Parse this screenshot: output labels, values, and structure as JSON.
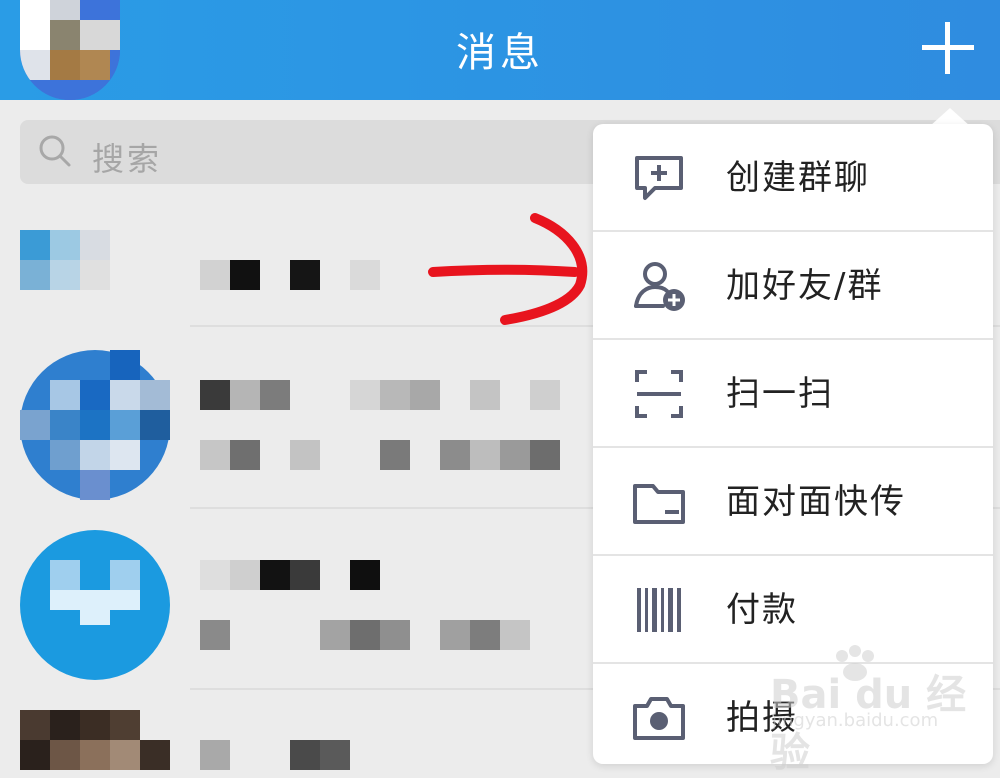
{
  "header": {
    "title": "消息",
    "add_icon": "plus-icon",
    "background": "#2a9ce6"
  },
  "search": {
    "placeholder": "搜索",
    "icon": "search-icon"
  },
  "menu": {
    "items": [
      {
        "label": "创建群聊",
        "icon": "chat-add-icon"
      },
      {
        "label": "加好友/群",
        "icon": "add-friend-icon"
      },
      {
        "label": "扫一扫",
        "icon": "scan-icon"
      },
      {
        "label": "面对面快传",
        "icon": "folder-icon"
      },
      {
        "label": "付款",
        "icon": "barcode-icon"
      },
      {
        "label": "拍摄",
        "icon": "camera-icon"
      }
    ],
    "icon_color": "#5a5f73"
  },
  "annotation": {
    "arrow_color": "#e8141e"
  },
  "watermark": {
    "text": "Bai du 经验",
    "sub": "jingyan.baidu.com"
  }
}
